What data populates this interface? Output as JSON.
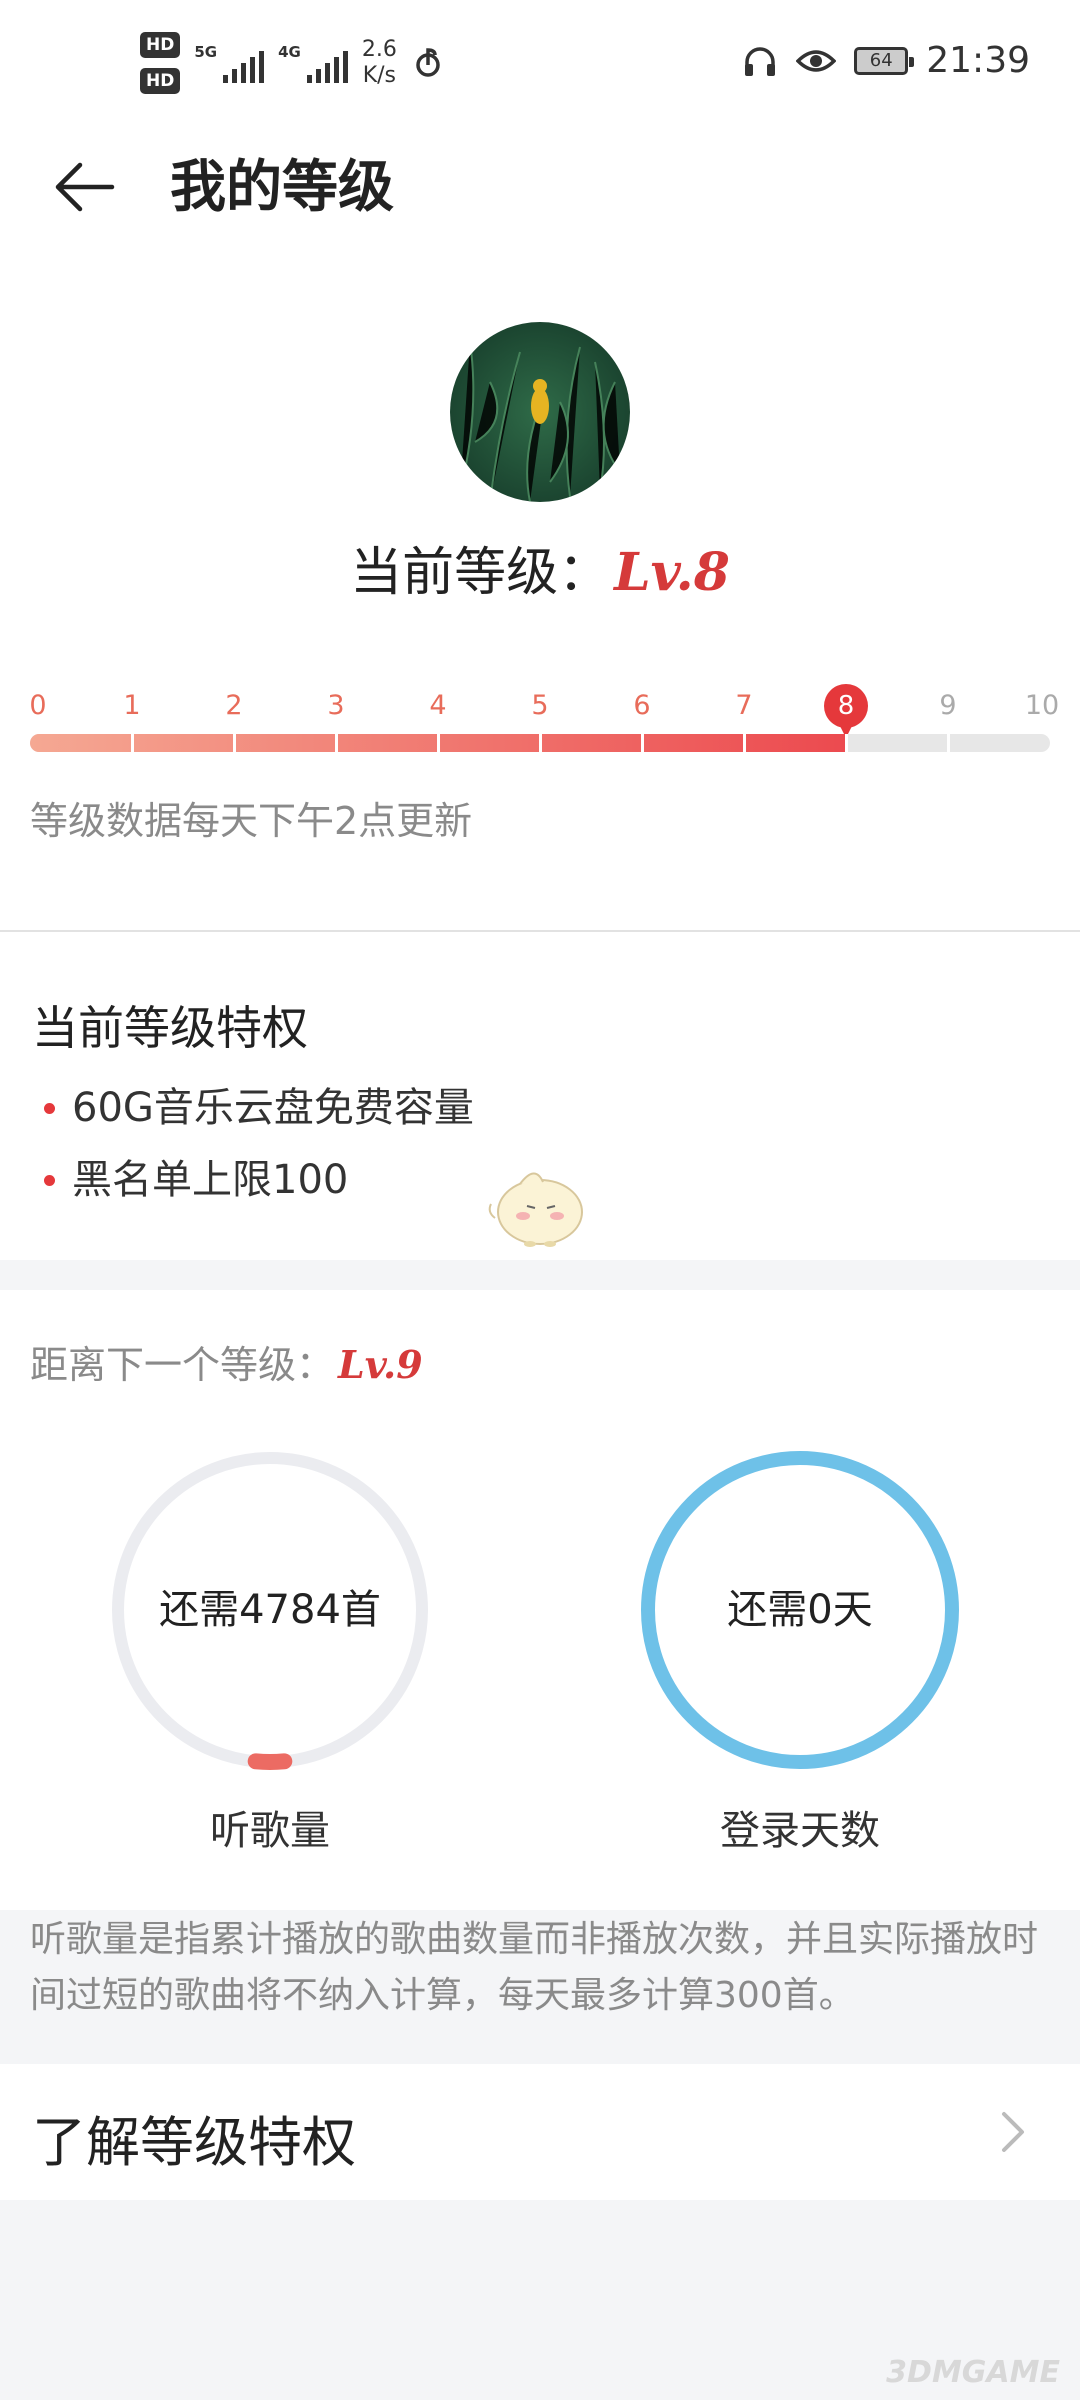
{
  "status_bar": {
    "hd1": "HD",
    "hd2": "HD",
    "sim1_label": "5G",
    "sim2_label": "4G",
    "speed_value": "2.6",
    "speed_unit": "K/s",
    "battery": "64",
    "time": "21:39"
  },
  "header": {
    "title": "我的等级"
  },
  "current_level": {
    "label": "当前等级：",
    "value": "Lv.8"
  },
  "progress": {
    "levels": [
      "0",
      "1",
      "2",
      "3",
      "4",
      "5",
      "6",
      "7",
      "8",
      "9",
      "10"
    ],
    "current": 8,
    "max": 10,
    "note": "等级数据每天下午2点更新"
  },
  "privileges": {
    "title": "当前等级特权",
    "items": [
      "60G音乐云盘免费容量",
      "黑名单上限100"
    ]
  },
  "next_level": {
    "label": "距离下一个等级：",
    "value": "Lv.9",
    "songs": {
      "remaining_text": "还需4784首",
      "caption": "听歌量",
      "progress_fraction": 0.03,
      "color": "#ec6b63"
    },
    "login": {
      "remaining_text": "还需0天",
      "caption": "登录天数",
      "progress_fraction": 1.0,
      "color": "#6ec1e8"
    }
  },
  "explanation": "听歌量是指累计播放的歌曲数量而非播放次数，并且实际播放时间过短的歌曲将不纳入计算，每天最多计算300首。",
  "learn_more": {
    "label": "了解等级特权"
  },
  "watermark": "3DMGAME",
  "colors": {
    "accent_red": "#e5383b",
    "ring_track": "#ebecf0"
  }
}
